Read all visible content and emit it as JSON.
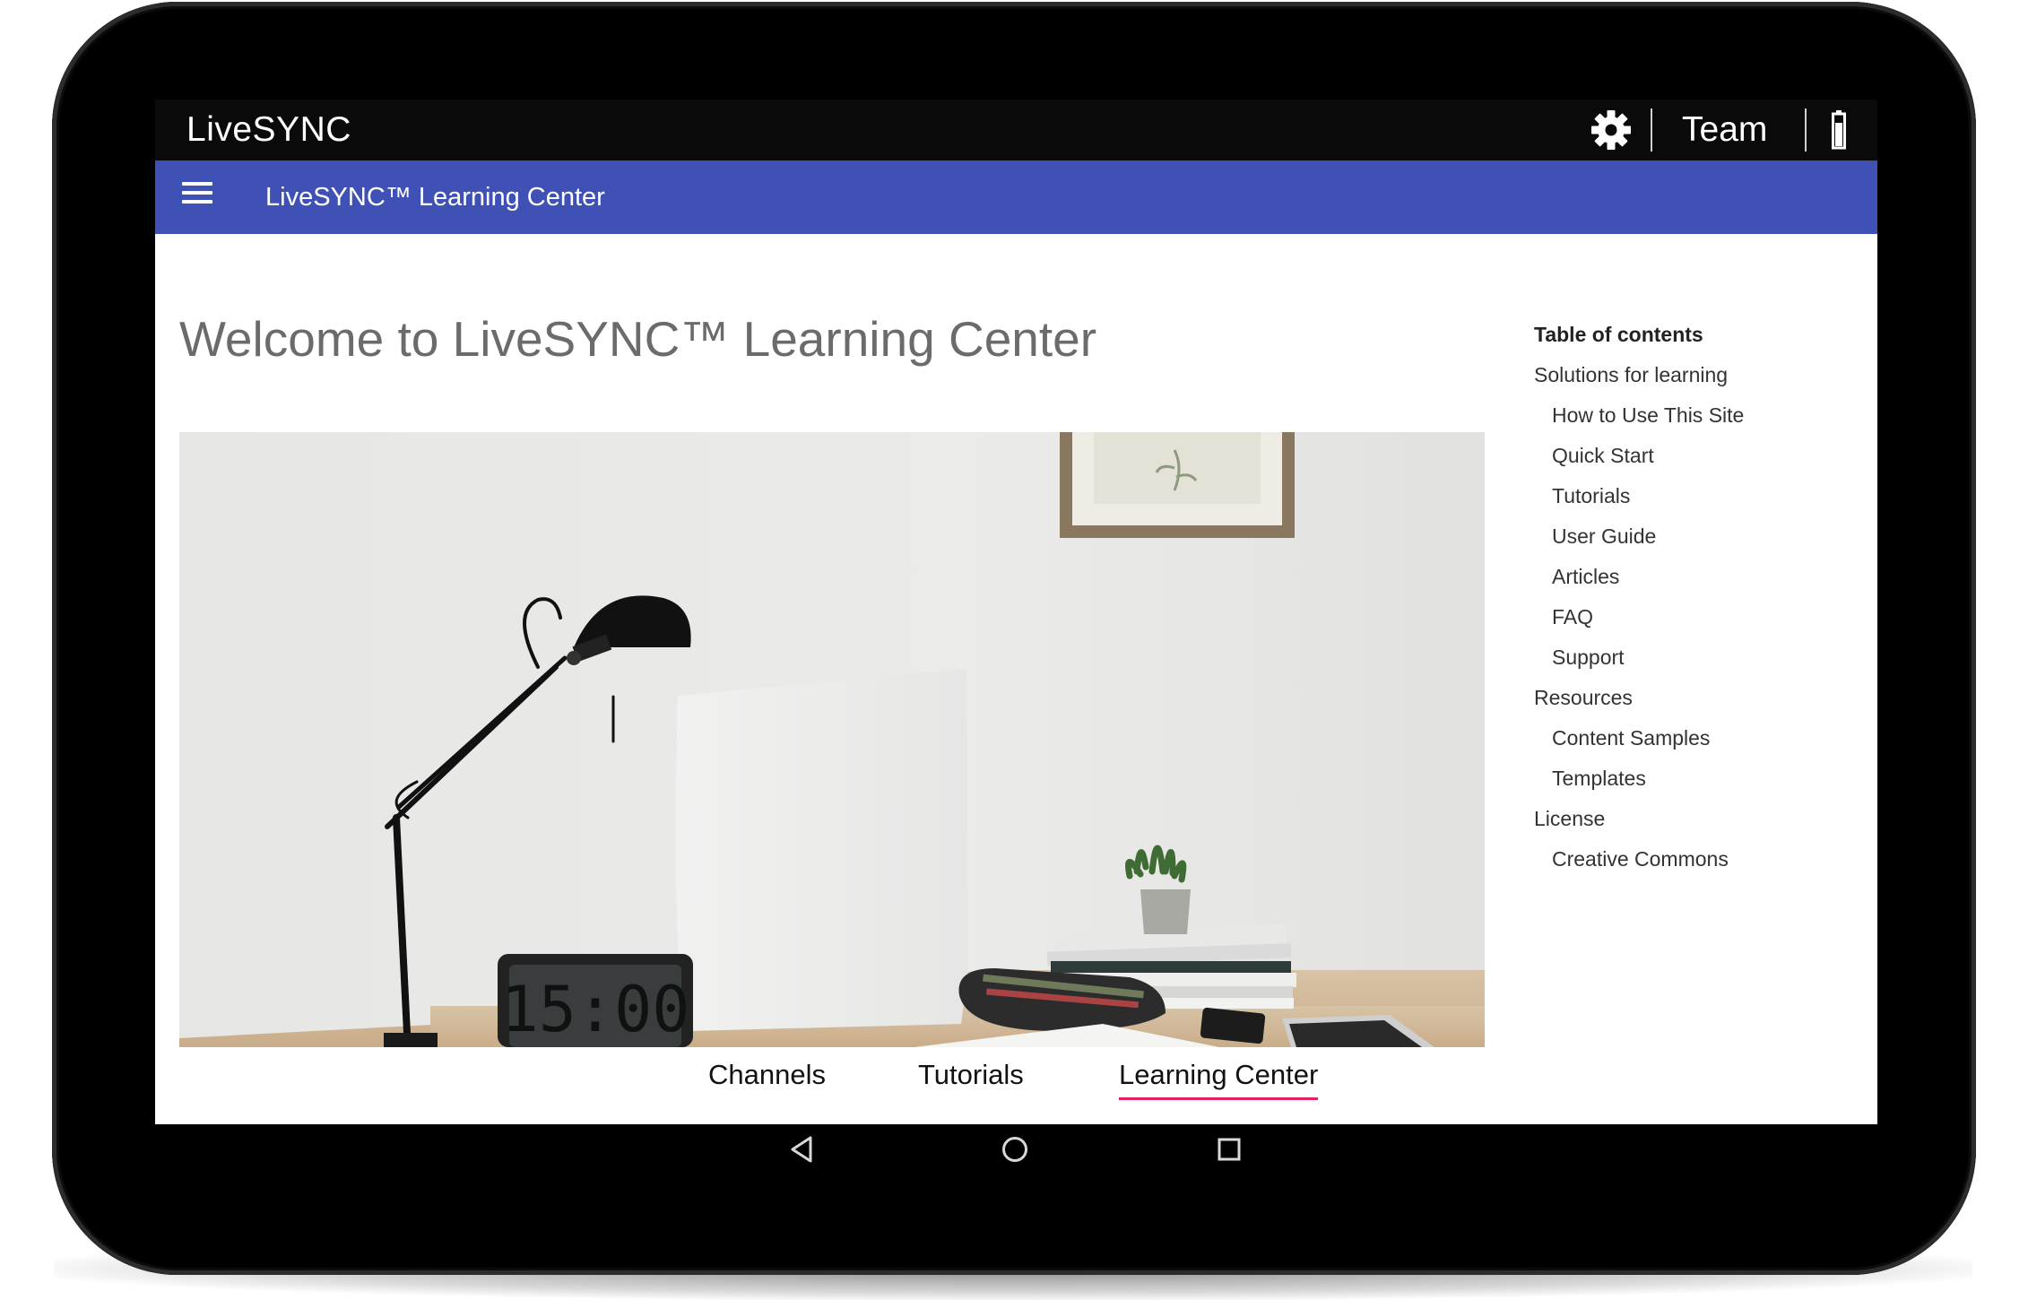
{
  "status_bar": {
    "brand": "LiveSYNC",
    "team_label": "Team"
  },
  "app_bar": {
    "title": "LiveSYNC™ Learning Center"
  },
  "main": {
    "page_title": "Welcome to LiveSYNC™ Learning Center",
    "hero_clock_text": "15:00"
  },
  "toc": {
    "heading": "Table of contents",
    "items": [
      {
        "label": "Solutions for learning",
        "level": 1
      },
      {
        "label": "How to Use This Site",
        "level": 2
      },
      {
        "label": "Quick Start",
        "level": 2
      },
      {
        "label": "Tutorials",
        "level": 2
      },
      {
        "label": "User Guide",
        "level": 2
      },
      {
        "label": "Articles",
        "level": 2
      },
      {
        "label": "FAQ",
        "level": 2
      },
      {
        "label": "Support",
        "level": 2
      },
      {
        "label": "Resources",
        "level": 1
      },
      {
        "label": "Content Samples",
        "level": 2
      },
      {
        "label": "Templates",
        "level": 2
      },
      {
        "label": "License",
        "level": 1
      },
      {
        "label": "Creative Commons",
        "level": 2
      }
    ]
  },
  "bottom_tabs": [
    {
      "label": "Channels",
      "active": false
    },
    {
      "label": "Tutorials",
      "active": false
    },
    {
      "label": "Learning Center",
      "active": true
    }
  ],
  "colors": {
    "app_bar": "#3f51b5",
    "active_tab_underline": "#e91e63",
    "status_bar": "#0a0a0a"
  },
  "icons": [
    "gear-icon",
    "battery-icon",
    "menu-icon",
    "back-icon",
    "home-icon",
    "recents-icon"
  ]
}
